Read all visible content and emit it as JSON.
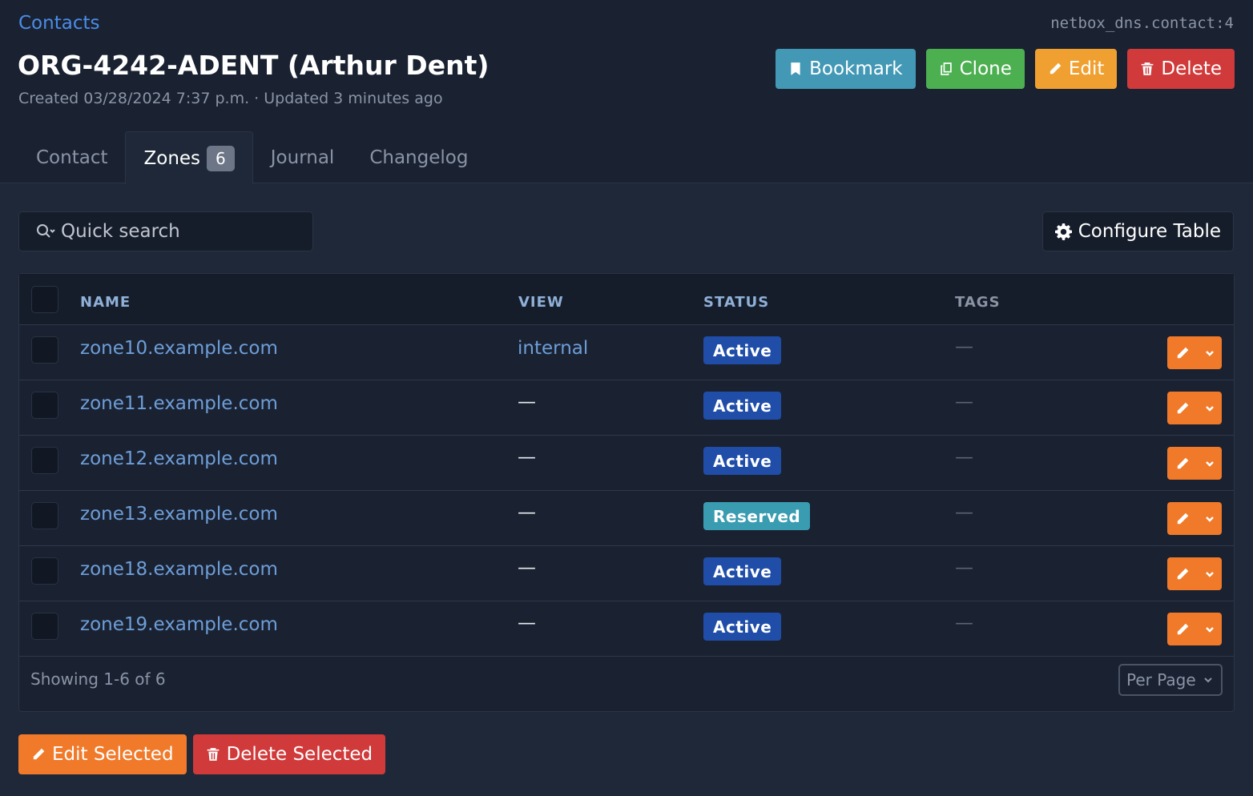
{
  "header": {
    "breadcrumb": "Contacts",
    "object_id": "netbox_dns.contact:4",
    "title": "ORG-4242-ADENT (Arthur Dent)",
    "meta": "Created 03/28/2024 7:37 p.m. · Updated 3 minutes ago",
    "buttons": {
      "bookmark": "Bookmark",
      "clone": "Clone",
      "edit": "Edit",
      "delete": "Delete"
    }
  },
  "tabs": [
    {
      "label": "Contact"
    },
    {
      "label": "Zones",
      "badge": "6"
    },
    {
      "label": "Journal"
    },
    {
      "label": "Changelog"
    }
  ],
  "search": {
    "placeholder": "Quick search"
  },
  "configure_table": "Configure Table",
  "table": {
    "columns": [
      "NAME",
      "VIEW",
      "STATUS",
      "TAGS"
    ],
    "rows": [
      {
        "name": "zone10.example.com",
        "view": "internal",
        "status": "Active",
        "tags": "—"
      },
      {
        "name": "zone11.example.com",
        "view": "—",
        "status": "Active",
        "tags": "—"
      },
      {
        "name": "zone12.example.com",
        "view": "—",
        "status": "Active",
        "tags": "—"
      },
      {
        "name": "zone13.example.com",
        "view": "—",
        "status": "Reserved",
        "tags": "—"
      },
      {
        "name": "zone18.example.com",
        "view": "—",
        "status": "Active",
        "tags": "—"
      },
      {
        "name": "zone19.example.com",
        "view": "—",
        "status": "Active",
        "tags": "—"
      }
    ],
    "showing": "Showing 1-6 of 6",
    "per_page": "Per Page"
  },
  "bulk_actions": {
    "edit_selected": "Edit Selected",
    "delete_selected": "Delete Selected"
  },
  "colors": {
    "active_badge": "#1f4da8",
    "reserved_badge": "#3a9cb0",
    "edit_accent": "#f07a2a",
    "link": "#6e9ed8"
  }
}
